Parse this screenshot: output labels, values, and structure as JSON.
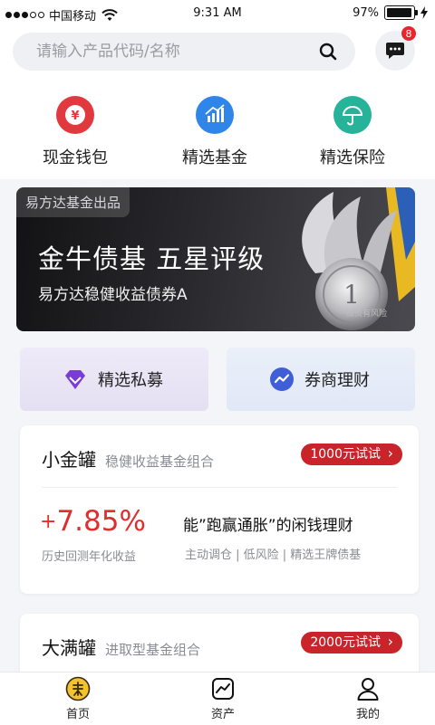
{
  "status": {
    "carrier": "中国移动",
    "time": "9:31 AM",
    "battery": "97%"
  },
  "search": {
    "placeholder": "请输入产品代码/名称"
  },
  "messages": {
    "badge": "8"
  },
  "quick": [
    {
      "label": "现金钱包",
      "icon": "yuan-icon",
      "color": "#e0393e"
    },
    {
      "label": "精选基金",
      "icon": "chart-up-icon",
      "color": "#2f86e8"
    },
    {
      "label": "精选保险",
      "icon": "umbrella-icon",
      "color": "#27b39a"
    }
  ],
  "banner": {
    "tag": "易方达基金出品",
    "title": "金牛债基 五星评级",
    "subtitle": "易方达稳健收益债券A",
    "risk": "投资有风险"
  },
  "features": [
    {
      "label": "精选私募",
      "icon": "diamond-icon"
    },
    {
      "label": "券商理财",
      "icon": "trend-icon"
    }
  ],
  "products": [
    {
      "name": "小金罐",
      "desc": "稳健收益基金组合",
      "button": "1000元试试",
      "rate": "7.85%",
      "rate_sign": "+",
      "rate_label": "历史回测年化收益",
      "slogan": "能”跑赢通胀”的闲钱理财",
      "tags": "主动调仓 | 低风险 | 精选王牌债基"
    },
    {
      "name": "大满罐",
      "desc": "进取型基金组合",
      "button": "2000元试试"
    }
  ],
  "tabs": [
    {
      "label": "首页",
      "icon": "home-coin-icon"
    },
    {
      "label": "资产",
      "icon": "asset-chart-icon"
    },
    {
      "label": "我的",
      "icon": "user-icon"
    }
  ],
  "colors": {
    "brand_red": "#c8242a",
    "rate_red": "#e02e2e",
    "accent_gold": "#e8b923"
  }
}
